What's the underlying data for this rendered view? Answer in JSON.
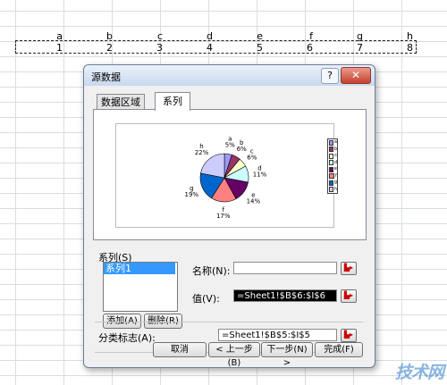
{
  "sheet": {
    "column_letters": [
      "a",
      "b",
      "c",
      "d",
      "e",
      "f",
      "g",
      "h"
    ],
    "row_numbers": [
      "1",
      "2",
      "3",
      "4",
      "5",
      "6",
      "7",
      "8"
    ]
  },
  "dialog": {
    "title": "源数据",
    "help_label": "?",
    "close_label": "✕",
    "tabs": [
      "数据区域",
      "系列"
    ],
    "series_label": "系列(S)",
    "series_items": [
      "系列1"
    ],
    "add_button": "添加(A)",
    "remove_button": "删除(R)",
    "name_label": "名称(N):",
    "name_value": "",
    "value_label": "值(V):",
    "value_value": "=Sheet1!$B$6:$I$6",
    "category_label": "分类标志(A):",
    "category_value": "=Sheet1!$B$5:$I$5",
    "cancel_button": "取消",
    "back_button": "< 上一步(B)",
    "next_button": "下一步(N) >",
    "finish_button": "完成(F)"
  },
  "chart_data": {
    "type": "pie",
    "categories": [
      "a",
      "b",
      "c",
      "d",
      "e",
      "f",
      "g",
      "h"
    ],
    "values": [
      5,
      6,
      6,
      11,
      14,
      17,
      19,
      22
    ],
    "data_labels": [
      "a\n5%",
      "b\n6%",
      "c\n6%",
      "d\n11%",
      "e\n14%",
      "f\n17%",
      "g\n19%",
      "h\n22%"
    ],
    "colors": [
      "#9a9aff",
      "#993366",
      "#ffffcc",
      "#ccffff",
      "#660066",
      "#ff8080",
      "#0066cc",
      "#ccccff"
    ],
    "legend": "right",
    "title": ""
  },
  "watermark": "技术网"
}
